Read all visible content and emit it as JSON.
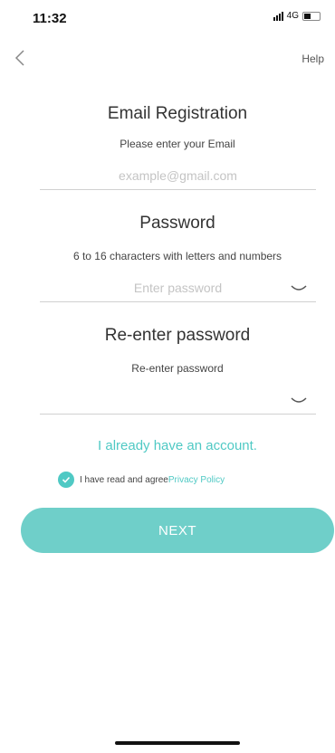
{
  "status_bar": {
    "time": "11:32",
    "network": "4G"
  },
  "nav": {
    "help_label": "Help"
  },
  "email": {
    "title": "Email Registration",
    "hint": "Please enter your Email",
    "placeholder": "example@gmail.com",
    "value": ""
  },
  "password": {
    "title": "Password",
    "hint": "6 to 16 characters with letters and numbers",
    "placeholder": "Enter password",
    "value": ""
  },
  "confirm": {
    "title": "Re-enter password",
    "hint": "Re-enter password",
    "placeholder": "",
    "value": ""
  },
  "account_link": "I already have an account.",
  "agreement": {
    "checked": true,
    "text": "I have read and agree",
    "link": "Privacy Policy"
  },
  "next_label": "NEXT",
  "colors": {
    "accent": "#4fc9c4",
    "button": "#6fcfc9"
  }
}
